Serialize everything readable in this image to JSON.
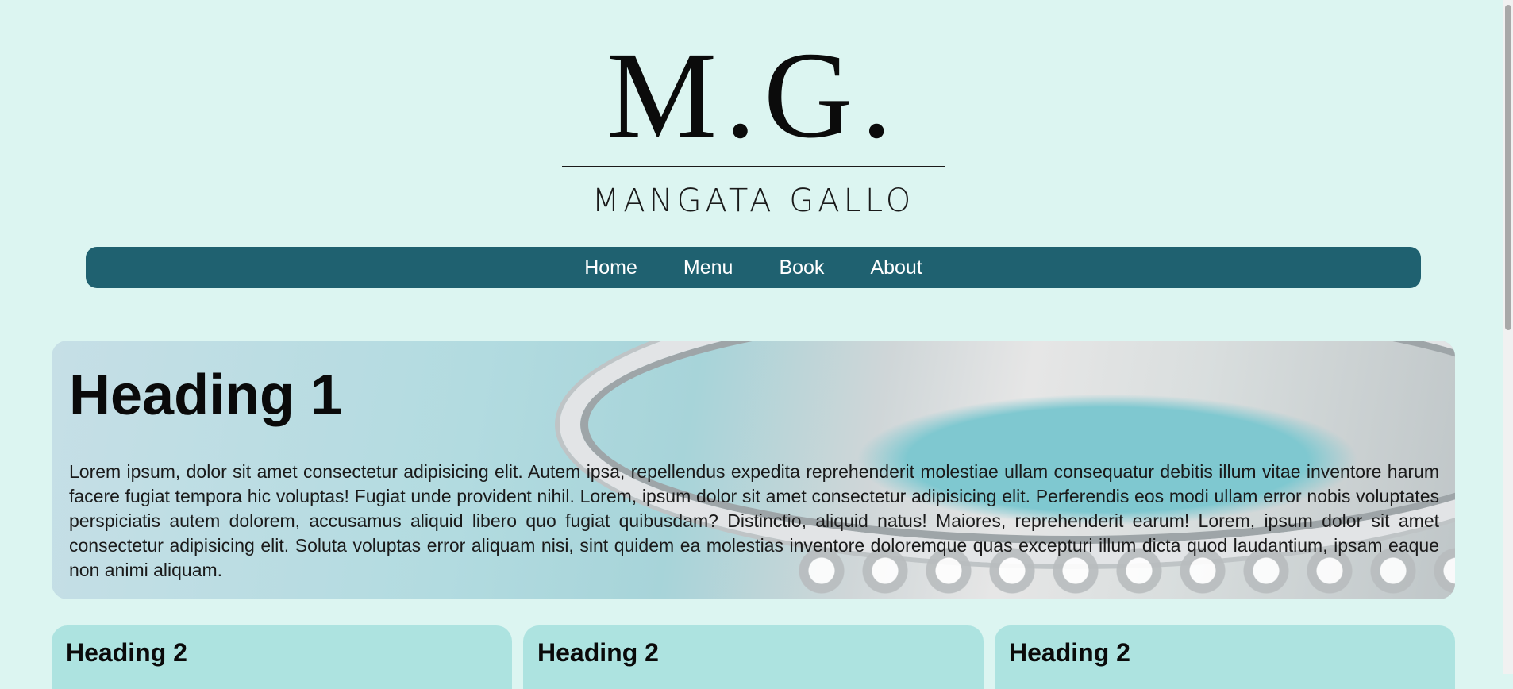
{
  "logo": {
    "mark": "M.G.",
    "name": "MANGATA GALLO"
  },
  "nav": {
    "items": [
      "Home",
      "Menu",
      "Book",
      "About"
    ]
  },
  "hero": {
    "heading": "Heading 1",
    "text": "Lorem ipsum, dolor sit amet consectetur adipisicing elit. Autem ipsa, repellendus expedita reprehenderit molestiae ullam consequatur debitis illum vitae inventore harum facere fugiat tempora hic voluptas! Fugiat unde provident nihil. Lorem, ipsum dolor sit amet consectetur adipisicing elit. Perferendis eos modi ullam error nobis voluptates perspiciatis autem dolorem, accusamus aliquid libero quo fugiat quibusdam? Distinctio, aliquid natus! Maiores, reprehenderit earum! Lorem, ipsum dolor sit amet consectetur adipisicing elit. Soluta voluptas error aliquam nisi, sint quidem ea molestias inventore doloremque quas excepturi illum dicta quod laudantium, ipsam eaque non animi aliquam."
  },
  "cards": [
    {
      "heading": "Heading 2"
    },
    {
      "heading": "Heading 2"
    },
    {
      "heading": "Heading 2"
    }
  ],
  "colors": {
    "page_background": "#dcf5f1",
    "nav_background": "#1f6170",
    "card_background": "#ade3e0"
  }
}
